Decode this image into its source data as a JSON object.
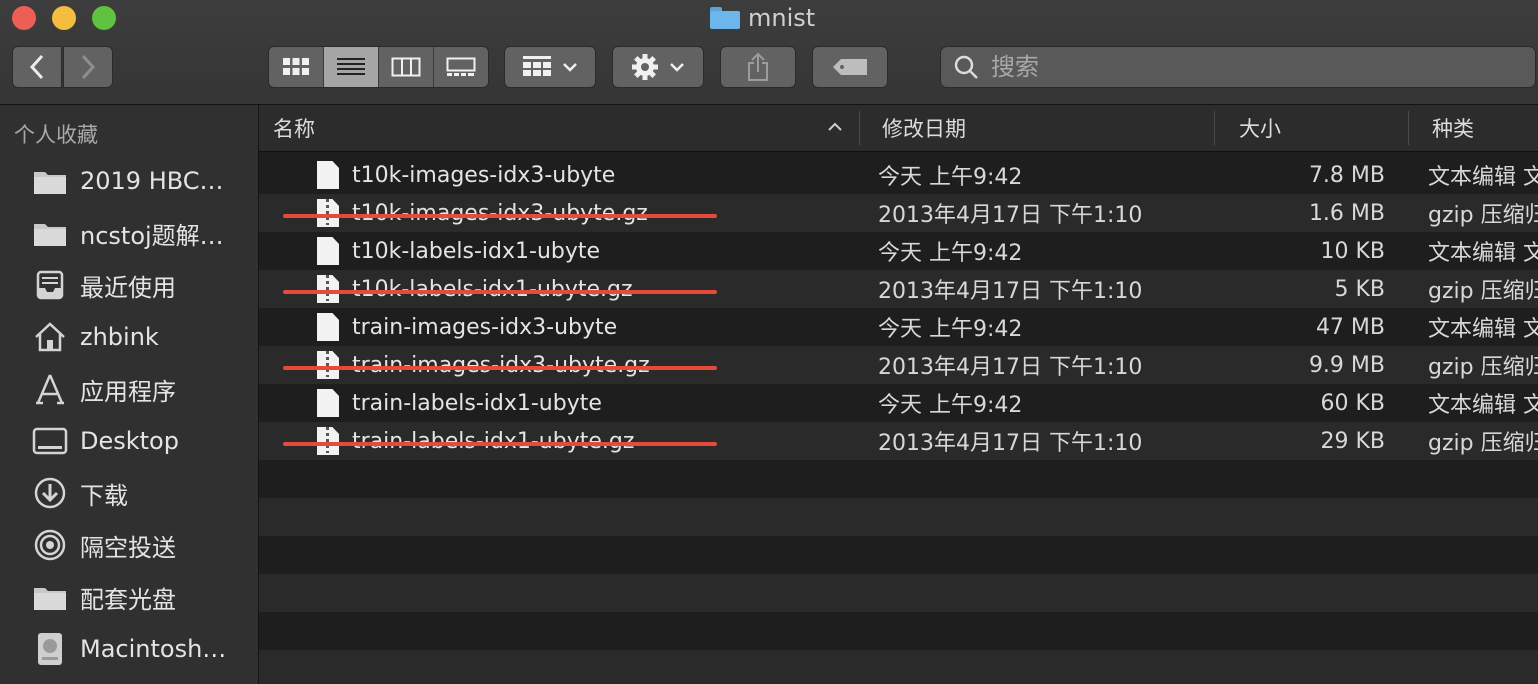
{
  "window": {
    "title": "mnist"
  },
  "search": {
    "placeholder": "搜索"
  },
  "sidebar": {
    "heading": "个人收藏",
    "items": [
      {
        "label": "2019 HBC…",
        "icon": "folder-icon"
      },
      {
        "label": "ncstoj题解…",
        "icon": "folder-icon"
      },
      {
        "label": "最近使用",
        "icon": "recents-icon"
      },
      {
        "label": "zhbink",
        "icon": "home-icon"
      },
      {
        "label": "应用程序",
        "icon": "applications-icon"
      },
      {
        "label": "Desktop",
        "icon": "desktop-icon"
      },
      {
        "label": "下载",
        "icon": "downloads-icon"
      },
      {
        "label": "隔空投送",
        "icon": "airdrop-icon"
      },
      {
        "label": "配套光盘",
        "icon": "folder-icon"
      },
      {
        "label": "Macintosh…",
        "icon": "disk-icon"
      }
    ]
  },
  "columns": {
    "name": "名称",
    "date": "修改日期",
    "size": "大小",
    "kind": "种类"
  },
  "files": [
    {
      "name": "t10k-images-idx3-ubyte",
      "date": "今天 上午9:42",
      "size": "7.8 MB",
      "kind": "文本编辑 文稿",
      "struck": false,
      "zip": false
    },
    {
      "name": "t10k-images-idx3-ubyte.gz",
      "date": "2013年4月17日 下午1:10",
      "size": "1.6 MB",
      "kind": "gzip 压缩归档",
      "struck": true,
      "zip": true
    },
    {
      "name": "t10k-labels-idx1-ubyte",
      "date": "今天 上午9:42",
      "size": "10 KB",
      "kind": "文本编辑 文稿",
      "struck": false,
      "zip": false
    },
    {
      "name": "t10k-labels-idx1-ubyte.gz",
      "date": "2013年4月17日 下午1:10",
      "size": "5 KB",
      "kind": "gzip 压缩归档",
      "struck": true,
      "zip": true
    },
    {
      "name": "train-images-idx3-ubyte",
      "date": "今天 上午9:42",
      "size": "47 MB",
      "kind": "文本编辑 文稿",
      "struck": false,
      "zip": false
    },
    {
      "name": "train-images-idx3-ubyte.gz",
      "date": "2013年4月17日 下午1:10",
      "size": "9.9 MB",
      "kind": "gzip 压缩归档",
      "struck": true,
      "zip": true
    },
    {
      "name": "train-labels-idx1-ubyte",
      "date": "今天 上午9:42",
      "size": "60 KB",
      "kind": "文本编辑 文稿",
      "struck": false,
      "zip": false
    },
    {
      "name": "train-labels-idx1-ubyte.gz",
      "date": "2013年4月17日 下午1:10",
      "size": "29 KB",
      "kind": "gzip 压缩归档",
      "struck": true,
      "zip": true
    }
  ],
  "colors": {
    "strike": "#e84a3a",
    "folder": "#6cb6ec"
  }
}
